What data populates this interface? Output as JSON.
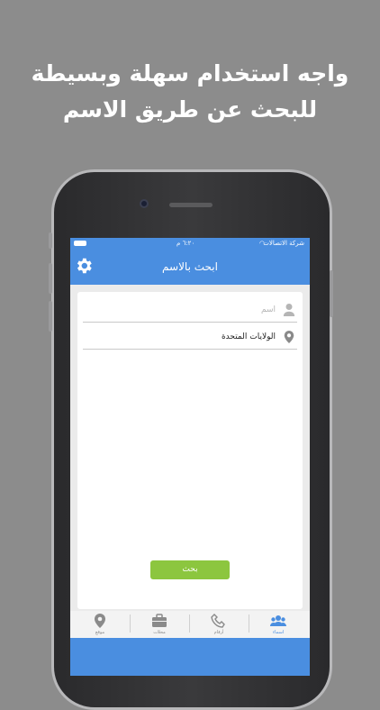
{
  "promo": {
    "line1": "واجه استخدام سهلة وبسيطة",
    "line2": "للبحث عن طريق الاسم"
  },
  "status": {
    "carrier": "شركة الاتصالات",
    "time": "٦:٢٠ م"
  },
  "nav": {
    "title": "ابحث بالاسم",
    "settings_icon": "gear-icon"
  },
  "form": {
    "name_placeholder": "اسم",
    "location_value": "الولايات المتحدة",
    "search_label": "بحث"
  },
  "tabs": [
    {
      "label": "موقع",
      "icon": "location-pin-icon"
    },
    {
      "label": "محلات",
      "icon": "briefcase-icon"
    },
    {
      "label": "أرقام",
      "icon": "phone-icon"
    },
    {
      "label": "اسماء",
      "icon": "people-icon",
      "active": true
    }
  ],
  "colors": {
    "accent": "#4a8ee0",
    "button": "#8cc63f",
    "background": "#8c8c8c"
  }
}
